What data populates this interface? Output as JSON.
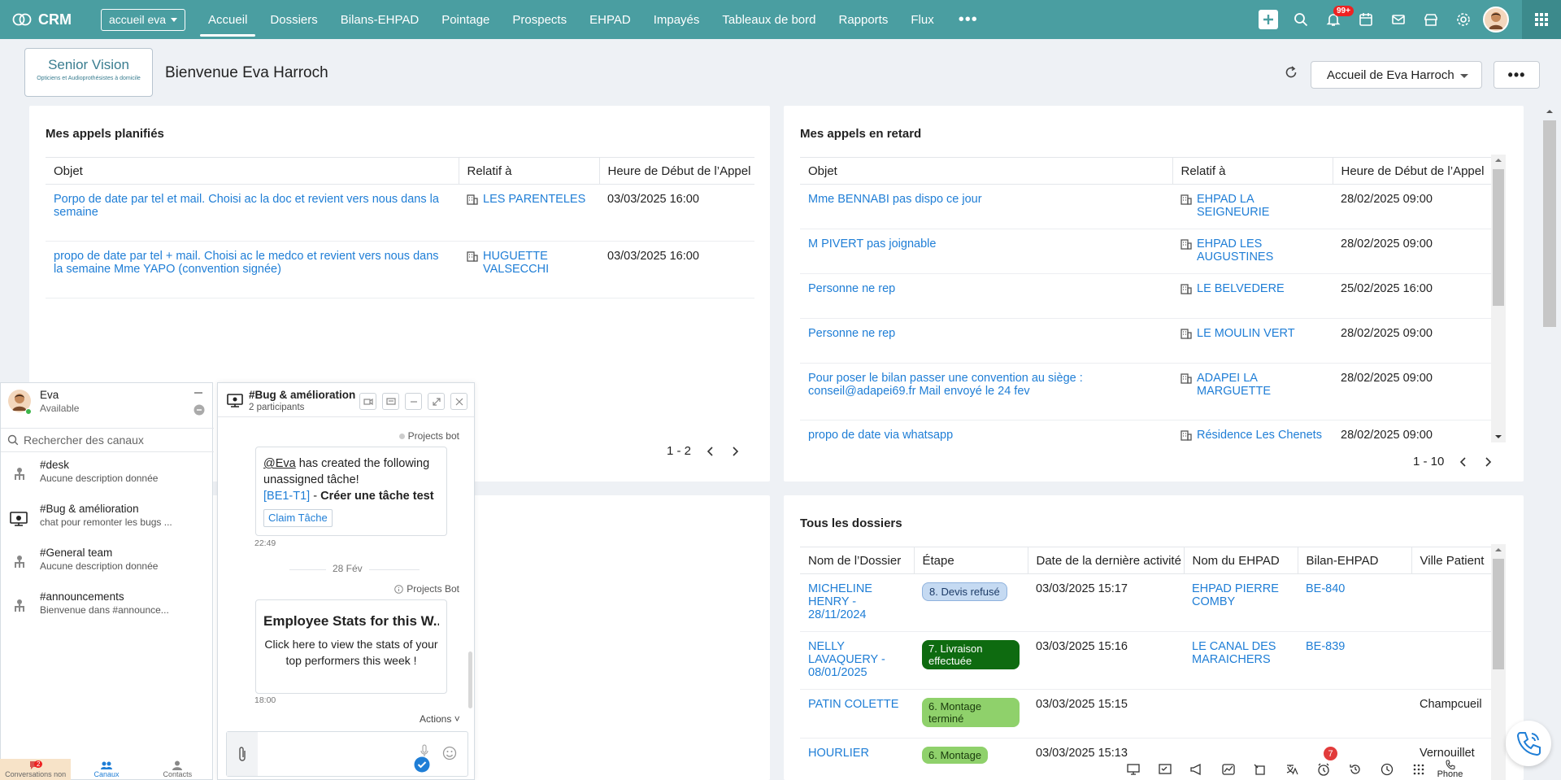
{
  "topbar": {
    "app_name": "CRM",
    "workspace": "accueil eva",
    "nav": [
      "Accueil",
      "Dossiers",
      "Bilans-EHPAD",
      "Pointage",
      "Prospects",
      "EHPAD",
      "Impayés",
      "Tableaux de bord",
      "Rapports",
      "Flux"
    ],
    "active_nav": "Accueil",
    "notifications_badge": "99+"
  },
  "header": {
    "logo_name": "Senior Vision",
    "logo_tagline": "Opticiens et Audioprothésistes à domicile",
    "welcome": "Bienvenue Eva Harroch",
    "homepage_select": "Accueil de Eva Harroch"
  },
  "planned_calls": {
    "title": "Mes appels planifiés",
    "columns": [
      "Objet",
      "Relatif à",
      "Heure de Début de l’Appel"
    ],
    "rows": [
      {
        "subject": "Porpo de date par tel et mail. Choisi ac la doc et revient vers nous dans la semaine",
        "related": "LES PARENTELES",
        "time": "03/03/2025 16:00"
      },
      {
        "subject": "propo de date par tel + mail. Choisi ac le medco et revient vers nous dans la semaine Mme YAPO (convention signée)",
        "related": "HUGUETTE VALSECCHI",
        "time": "03/03/2025 16:00"
      }
    ],
    "pagination": "1 - 2"
  },
  "late_calls": {
    "title": "Mes appels en retard",
    "columns": [
      "Objet",
      "Relatif à",
      "Heure de Début de l’Appel"
    ],
    "rows": [
      {
        "subject": "Mme BENNABI pas dispo ce jour",
        "related": "EHPAD LA SEIGNEURIE",
        "time": "28/02/2025 09:00"
      },
      {
        "subject": "M PIVERT pas joignable",
        "related": "EHPAD LES AUGUSTINES",
        "time": "28/02/2025 09:00"
      },
      {
        "subject": "Personne ne rep",
        "related": "LE BELVEDERE",
        "time": "25/02/2025 16:00"
      },
      {
        "subject": "Personne ne rep",
        "related": "LE MOULIN VERT",
        "time": "28/02/2025 09:00"
      },
      {
        "subject": "Pour poser le bilan passer une convention au siège : conseil@adapei69.fr Mail envoyé le 24 fev",
        "related": "ADAPEI LA MARGUETTE",
        "time": "28/02/2025 09:00"
      },
      {
        "subject": "propo de date via whatsapp",
        "related": "Résidence Les Chenets",
        "time": "28/02/2025 09:00"
      }
    ],
    "pagination": "1 - 10"
  },
  "all_files": {
    "title": "Tous les dossiers",
    "columns": [
      "Nom de l’Dossier",
      "Étape",
      "Date de la dernière activité",
      "Nom du EHPAD",
      "Bilan-EHPAD",
      "Ville Patient"
    ],
    "rows": [
      {
        "name": "MICHELINE HENRY - 28/11/2024",
        "stage": "8. Devis refusé",
        "stage_color": "#c5daf2",
        "stage_text": "#1b3a66",
        "date": "03/03/2025 15:17",
        "ehpad": "EHPAD PIERRE COMBY",
        "bilan": "BE-840",
        "city": ""
      },
      {
        "name": "NELLY LAVAQUERY - 08/01/2025",
        "stage": "7. Livraison effectuée",
        "stage_color": "#0e6b10",
        "stage_text": "#ffffff",
        "date": "03/03/2025 15:16",
        "ehpad": "LE CANAL DES MARAICHERS",
        "bilan": "BE-839",
        "city": ""
      },
      {
        "name": "PATIN COLETTE",
        "stage": "6. Montage terminé",
        "stage_color": "#8fd16b",
        "stage_text": "#1a3a0d",
        "date": "03/03/2025 15:15",
        "ehpad": "",
        "bilan": "",
        "city": "Champcueil"
      },
      {
        "name": "HOURLIER",
        "stage": "6. Montage",
        "stage_color": "#8fd16b",
        "stage_text": "#1a3a0d",
        "date": "03/03/2025 15:13",
        "ehpad": "",
        "bilan": "",
        "city": "Vernouillet"
      }
    ]
  },
  "chat": {
    "user_name": "Eva",
    "user_status": "Available",
    "search_placeholder": "Rechercher des canaux",
    "channels": [
      {
        "name": "#desk",
        "desc": "Aucune description donnée"
      },
      {
        "name": "#Bug & amélioration",
        "desc": "chat pour remonter les bugs ..."
      },
      {
        "name": "#General team",
        "desc": "Aucune description donnée"
      },
      {
        "name": "#announcements",
        "desc": "Bienvenue dans #announce..."
      }
    ],
    "tabs": [
      "Conversations non",
      "Canaux",
      "Contacts"
    ],
    "conversations_badge": "2",
    "window": {
      "title": "#Bug & amélioration",
      "participants": "2 participants",
      "bot1": "Projects bot",
      "msg_mention": "@Eva",
      "msg_text": " has created the following unassigned tâche!",
      "task_id": "[BE1-T1]",
      "task_sep": " - ",
      "task_title": "Créer une tâche test",
      "claim_label": "Claim Tâche",
      "time1": "22:49",
      "date_sep": "28 Fév",
      "bot2": "Projects Bot",
      "card_title": "Employee Stats for this W...",
      "card_body": "Click here to view the stats of your top performers this week !",
      "time2": "18:00",
      "actions_label": "Actions"
    }
  },
  "status_bar": {
    "reminder_badge": "7",
    "phone_label": "Phone"
  }
}
